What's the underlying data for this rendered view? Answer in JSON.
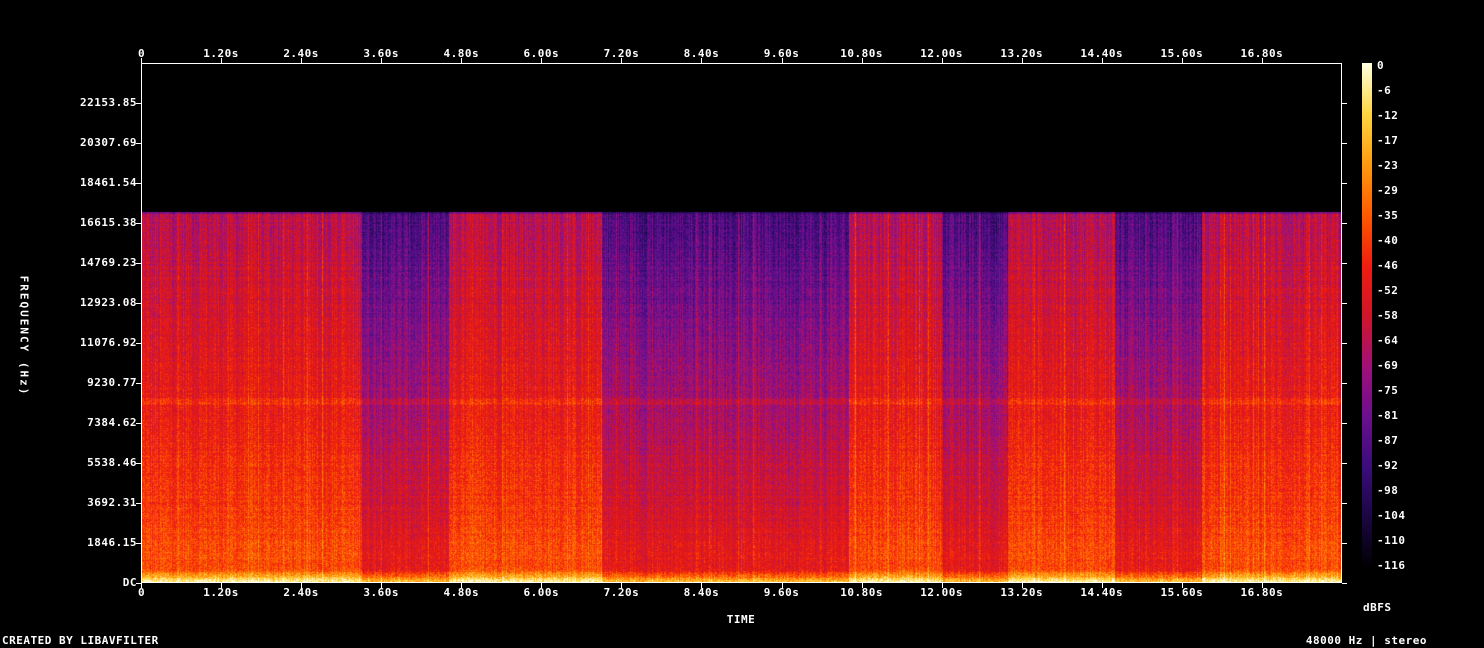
{
  "chart_data": {
    "type": "heatmap",
    "title": "",
    "xlabel": "TIME",
    "ylabel": "FREQUENCY (Hz)",
    "x_tick_labels": [
      "0",
      "1.20s",
      "2.40s",
      "3.60s",
      "4.80s",
      "6.00s",
      "7.20s",
      "8.40s",
      "9.60s",
      "10.80s",
      "12.00s",
      "13.20s",
      "14.40s",
      "15.60s",
      "16.80s"
    ],
    "x_tick_values": [
      0,
      1.2,
      2.4,
      3.6,
      4.8,
      6.0,
      7.2,
      8.4,
      9.6,
      10.8,
      12.0,
      13.2,
      14.4,
      15.6,
      16.8
    ],
    "xlim": [
      0,
      18.0
    ],
    "y_tick_labels": [
      "DC",
      "1846.15",
      "3692.31",
      "5538.46",
      "7384.62",
      "9230.77",
      "11076.92",
      "12923.08",
      "14769.23",
      "16615.38",
      "18461.54",
      "20307.69",
      "22153.85"
    ],
    "y_tick_values": [
      0,
      1846.15,
      3692.31,
      5538.46,
      7384.62,
      9230.77,
      11076.92,
      12923.08,
      14769.23,
      16615.38,
      18461.54,
      20307.69,
      22153.85
    ],
    "ylim": [
      0,
      24000
    ],
    "colorbar": {
      "unit": "dBFS",
      "tick_labels": [
        "0",
        "-6",
        "-12",
        "-17",
        "-23",
        "-29",
        "-35",
        "-40",
        "-46",
        "-52",
        "-58",
        "-64",
        "-69",
        "-75",
        "-81",
        "-87",
        "-92",
        "-98",
        "-104",
        "-110",
        "-116"
      ],
      "range": [
        -120,
        0
      ],
      "colormap": [
        "#000000",
        "#1a0640",
        "#3a0c7a",
        "#6a0f8e",
        "#a0107a",
        "#d0152a",
        "#f01d10",
        "#ff5a00",
        "#ff9a10",
        "#ffd640",
        "#ffffe0"
      ]
    },
    "lowpass_cutoff_hz": 17150,
    "loud_segments_s": [
      [
        0.0,
        3.3
      ],
      [
        4.6,
        6.9
      ],
      [
        10.6,
        12.0
      ],
      [
        13.0,
        14.6
      ],
      [
        15.9,
        18.0
      ]
    ],
    "quiet_segments_s": [
      [
        3.3,
        4.6
      ],
      [
        6.9,
        10.6
      ],
      [
        12.0,
        13.0
      ],
      [
        14.6,
        15.9
      ]
    ],
    "grid": false,
    "legend": "right"
  },
  "footer": {
    "left": "CREATED BY LIBAVFILTER",
    "right": "48000 Hz | stereo"
  }
}
